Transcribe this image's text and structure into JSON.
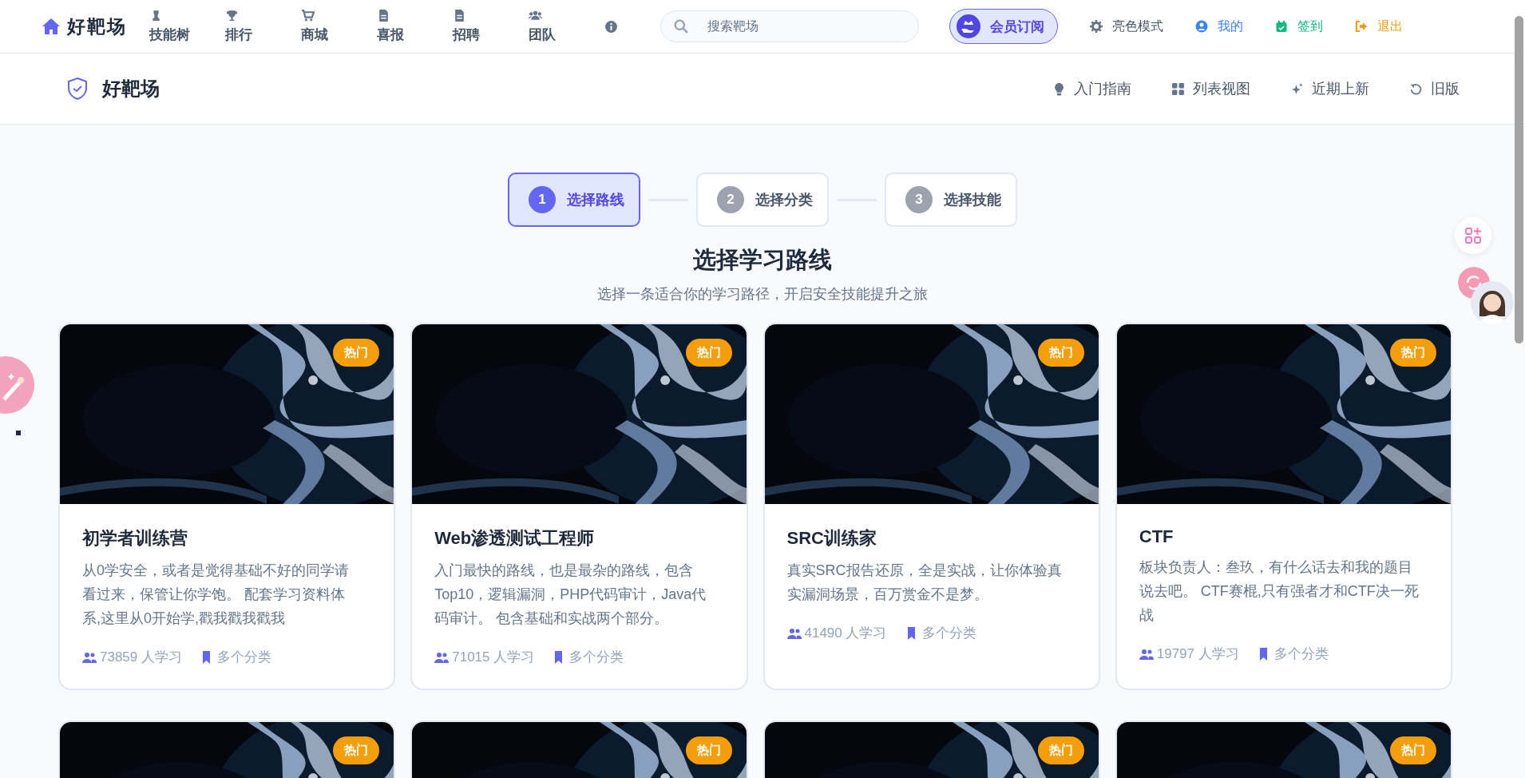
{
  "topnav": {
    "logo": "好靶场",
    "items": [
      {
        "label": "技能树",
        "kind": "chess"
      },
      {
        "label": "排行",
        "kind": "trophy"
      },
      {
        "label": "商城",
        "kind": "cart"
      },
      {
        "label": "喜报",
        "kind": "file"
      },
      {
        "label": "招聘",
        "kind": "file"
      },
      {
        "label": "团队",
        "kind": "users"
      },
      {
        "kind": "info"
      }
    ],
    "search": {
      "placeholder": "搜索靶场"
    },
    "member_button": "会员订阅",
    "links": [
      {
        "label": "亮色模式",
        "kind": "theme"
      },
      {
        "label": "我的",
        "kind": "user"
      },
      {
        "label": "签到",
        "kind": "checkin"
      },
      {
        "label": "退出",
        "kind": "logout"
      }
    ]
  },
  "subheader": {
    "brand": "好靶场",
    "links": [
      {
        "label": "入门指南",
        "kind": "bulb"
      },
      {
        "label": "列表视图",
        "kind": "grid"
      },
      {
        "label": "近期上新",
        "kind": "sparkle"
      },
      {
        "label": "旧版",
        "kind": "refresh"
      }
    ]
  },
  "steps": [
    {
      "number": "1",
      "label": "选择路线",
      "selected": true
    },
    {
      "number": "2",
      "label": "选择分类",
      "selected": false
    },
    {
      "number": "3",
      "label": "选择技能",
      "selected": false
    }
  ],
  "heading": "选择学习路线",
  "subheading": "选择一条适合你的学习路径，开启安全技能提升之旅",
  "cards": [
    {
      "badge": "热门",
      "title": "初学者训练营",
      "description": "从0学安全，或者是觉得基础不好的同学请看过来，保管让你学饱。 配套学习资料体系,这里从0开始学,戳我戳我戳我",
      "learners": "73859 人学习",
      "categories": "多个分类"
    },
    {
      "badge": "热门",
      "title": "Web渗透测试工程师",
      "description": "入门最快的路线，也是最杂的路线，包含Top10，逻辑漏洞，PHP代码审计，Java代码审计。 包含基础和实战两个部分。",
      "learners": "71015 人学习",
      "categories": "多个分类"
    },
    {
      "badge": "热门",
      "title": "SRC训练家",
      "description": "真实SRC报告还原，全是实战，让你体验真实漏洞场景，百万赏金不是梦。",
      "learners": "41490 人学习",
      "categories": "多个分类"
    },
    {
      "badge": "热门",
      "title": "CTF",
      "description": "板块负责人：叁玖，有什么话去和我的题目说去吧。 CTF赛棍,只有强者才和CTF决一死战",
      "learners": "19797 人学习",
      "categories": "多个分类"
    },
    {
      "badge": "热门"
    },
    {
      "badge": "热门"
    },
    {
      "badge": "热门"
    },
    {
      "badge": "热门"
    }
  ]
}
